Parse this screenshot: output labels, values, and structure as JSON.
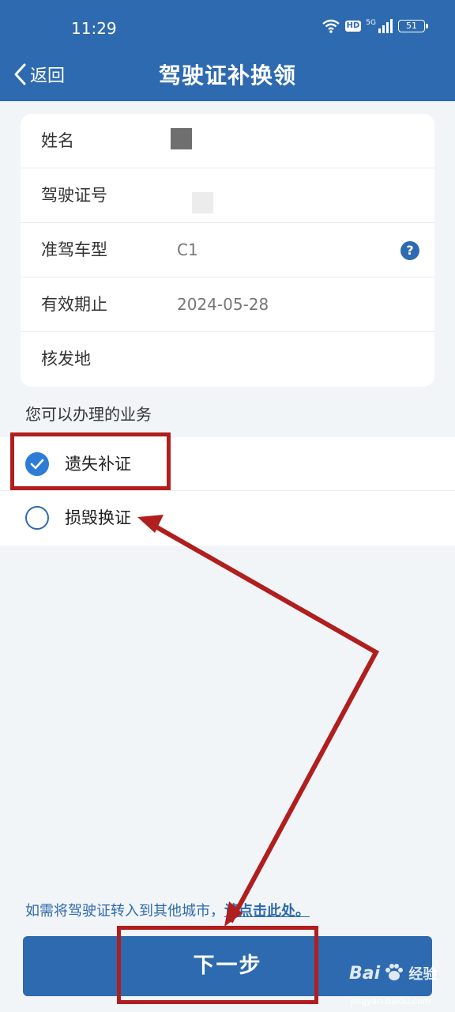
{
  "status_bar": {
    "time": "11:29",
    "hd_label": "HD",
    "network_label": "5G",
    "battery": "51"
  },
  "header": {
    "back_label": "返回",
    "title": "驾驶证补换领"
  },
  "license_info": {
    "rows": [
      {
        "label": "姓名",
        "value": ""
      },
      {
        "label": "驾驶证号",
        "value": ""
      },
      {
        "label": "准驾车型",
        "value": "C1"
      },
      {
        "label": "有效期止",
        "value": "2024-05-28"
      },
      {
        "label": "核发地",
        "value": ""
      }
    ],
    "help_icon": "?"
  },
  "services": {
    "title": "您可以办理的业务",
    "options": [
      {
        "label": "遗失补证",
        "checked": true
      },
      {
        "label": "损毁换证",
        "checked": false
      }
    ]
  },
  "footer": {
    "transfer_text": "如需将驾驶证转入到其他城市，",
    "transfer_link": "请点击此处。",
    "next_label": "下一步"
  },
  "watermark": {
    "brand": "Bai",
    "brand_suffix": "经验",
    "url": "jingyan.baidu.com"
  },
  "colors": {
    "primary": "#2e6aaf",
    "checked": "#2e7cd8",
    "annotation": "#b11e1e",
    "background": "#f2f5f8"
  }
}
